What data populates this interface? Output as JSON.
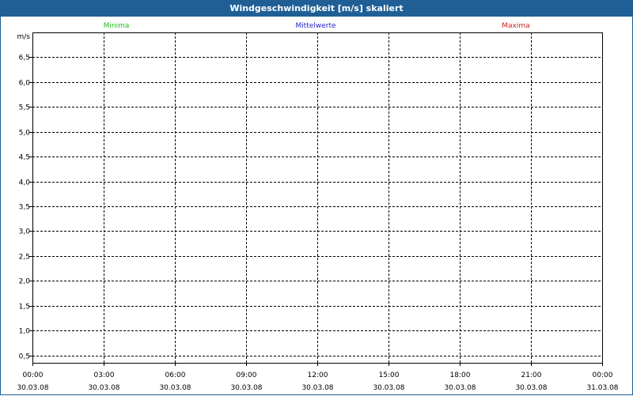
{
  "window": {
    "title": "Windgeschwindigkeit [m/s] skaliert"
  },
  "chart_data": {
    "type": "line",
    "title": "Windgeschwindigkeit [m/s] skaliert",
    "ylabel": "m/s",
    "ylim": [
      0.35,
      7.0
    ],
    "y_ticks": [
      "0,5",
      "1,0",
      "1,5",
      "2,0",
      "2,5",
      "3,0",
      "3,5",
      "4,0",
      "4,5",
      "5,0",
      "5,5",
      "6,0",
      "6,5"
    ],
    "y_tick_values": [
      0.5,
      1.0,
      1.5,
      2.0,
      2.5,
      3.0,
      3.5,
      4.0,
      4.5,
      5.0,
      5.5,
      6.0,
      6.5
    ],
    "x_ticks": [
      {
        "time": "00:00",
        "date": "30.03.08"
      },
      {
        "time": "03:00",
        "date": "30.03.08"
      },
      {
        "time": "06:00",
        "date": "30.03.08"
      },
      {
        "time": "09:00",
        "date": "30.03.08"
      },
      {
        "time": "12:00",
        "date": "30.03.08"
      },
      {
        "time": "15:00",
        "date": "30.03.08"
      },
      {
        "time": "18:00",
        "date": "30.03.08"
      },
      {
        "time": "21:00",
        "date": "30.03.08"
      },
      {
        "time": "00:00",
        "date": "31.03.08"
      }
    ],
    "grid": true,
    "legend_position": "top",
    "series": [
      {
        "name": "Minima",
        "color": "#22bb22",
        "values": []
      },
      {
        "name": "Mittelwerte",
        "color": "#2222cc",
        "values": []
      },
      {
        "name": "Maxima",
        "color": "#cc2222",
        "values": []
      }
    ]
  }
}
